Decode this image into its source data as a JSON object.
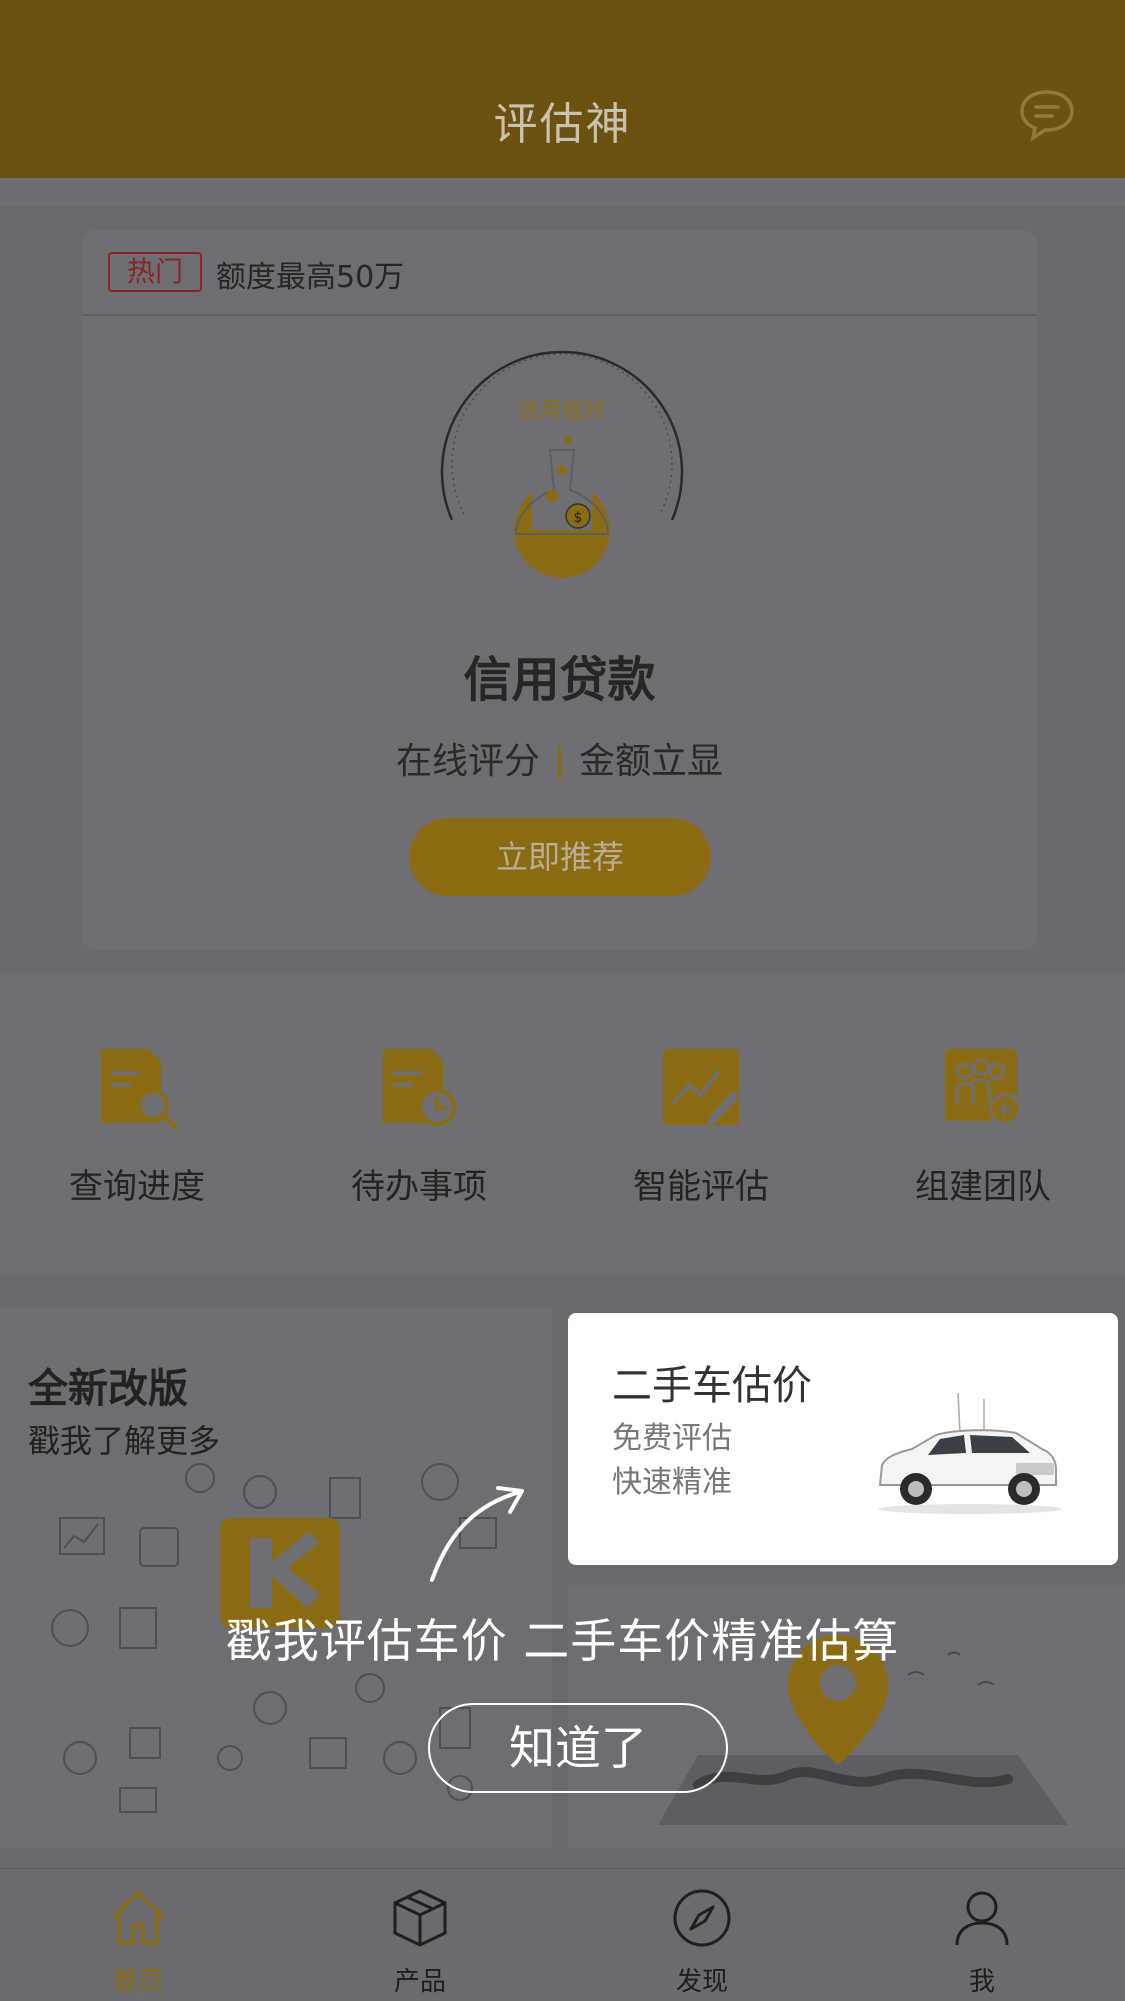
{
  "header": {
    "title": "评估神",
    "message_icon": "chat-bubble-icon"
  },
  "card": {
    "badge": "热门",
    "quota": "额度最高50万",
    "gauge_label": "信用极好",
    "title": "信用贷款",
    "sub_left": "在线评分",
    "sub_right": "金额立显",
    "button": "立即推荐"
  },
  "grid": [
    {
      "label": "查询进度",
      "icon": "search-document-icon"
    },
    {
      "label": "待办事项",
      "icon": "clock-document-icon"
    },
    {
      "label": "智能评估",
      "icon": "chart-pencil-icon"
    },
    {
      "label": "组建团队",
      "icon": "team-add-icon"
    }
  ],
  "promo_left": {
    "title": "全新改版",
    "subtitle": "戳我了解更多"
  },
  "spotlight": {
    "title": "二手车估价",
    "line1": "免费评估",
    "line2": "快速精准"
  },
  "guide": {
    "text": "戳我评估车价 二手车价精准估算",
    "button": "知道了"
  },
  "tabs": [
    {
      "label": "首页",
      "icon": "home-icon",
      "active": true
    },
    {
      "label": "产品",
      "icon": "box-icon",
      "active": false
    },
    {
      "label": "发现",
      "icon": "compass-icon",
      "active": false
    },
    {
      "label": "我",
      "icon": "user-icon",
      "active": false
    }
  ],
  "colors": {
    "accent": "#e8b420",
    "overlay": "#000000"
  }
}
